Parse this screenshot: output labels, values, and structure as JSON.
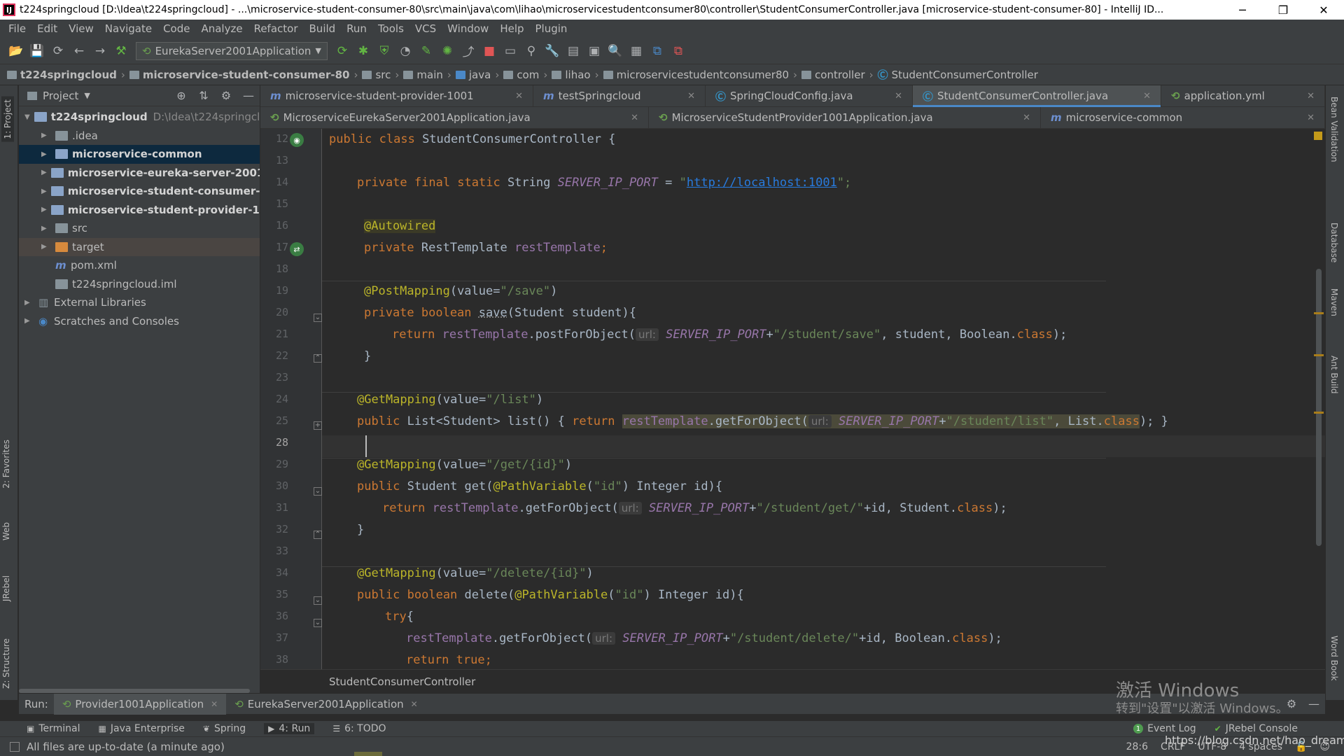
{
  "window": {
    "title": "t224springcloud [D:\\Idea\\t224springcloud] - ...\\microservice-student-consumer-80\\src\\main\\java\\com\\lihao\\microservicestudentconsumer80\\controller\\StudentConsumerController.java [microservice-student-consumer-80] - IntelliJ ID...",
    "app_icon": "IJ"
  },
  "menu": [
    "File",
    "Edit",
    "View",
    "Navigate",
    "Code",
    "Analyze",
    "Refactor",
    "Build",
    "Run",
    "Tools",
    "VCS",
    "Window",
    "Help",
    "Plugin"
  ],
  "toolbar": {
    "run_config": "EurekaServer2001Application"
  },
  "breadcrumb": [
    {
      "label": "t224springcloud",
      "bold": true
    },
    {
      "label": "microservice-student-consumer-80",
      "bold": true
    },
    {
      "label": "src"
    },
    {
      "label": "main"
    },
    {
      "label": "java"
    },
    {
      "label": "com"
    },
    {
      "label": "lihao"
    },
    {
      "label": "microservicestudentconsumer80"
    },
    {
      "label": "controller"
    },
    {
      "label": "StudentConsumerController"
    }
  ],
  "left_strip": {
    "project": "1: Project",
    "favorites": "2: Favorites",
    "web": "Web",
    "jrebel": "JRebel",
    "structure": "Z: Structure"
  },
  "right_strip": {
    "bean": "Bean Validation",
    "database": "Database",
    "maven": "Maven",
    "ant": "Ant Build",
    "word": "Word Book"
  },
  "project_panel": {
    "title": "Project",
    "tree": [
      {
        "label": "t224springcloud",
        "extra": "D:\\Idea\\t224springclou",
        "indent": 0,
        "arrow": "▼",
        "icon": "mod",
        "bold": true
      },
      {
        "label": ".idea",
        "indent": 1,
        "arrow": "▶",
        "icon": "fold"
      },
      {
        "label": "microservice-common",
        "indent": 1,
        "arrow": "▶",
        "icon": "mod",
        "bold": true,
        "selected": true
      },
      {
        "label": "microservice-eureka-server-2001",
        "indent": 1,
        "arrow": "▶",
        "icon": "mod",
        "bold": true
      },
      {
        "label": "microservice-student-consumer-80",
        "indent": 1,
        "arrow": "▶",
        "icon": "mod",
        "bold": true
      },
      {
        "label": "microservice-student-provider-1001",
        "indent": 1,
        "arrow": "▶",
        "icon": "mod",
        "bold": true
      },
      {
        "label": "src",
        "indent": 1,
        "arrow": "▶",
        "icon": "fold"
      },
      {
        "label": "target",
        "indent": 1,
        "arrow": "▶",
        "icon": "tgt",
        "highlighted": true
      },
      {
        "label": "pom.xml",
        "indent": 1,
        "arrow": "",
        "icon": "m"
      },
      {
        "label": "t224springcloud.iml",
        "indent": 1,
        "arrow": "",
        "icon": "fold"
      },
      {
        "label": "External Libraries",
        "indent": 0,
        "arrow": "▶",
        "icon": "lib"
      },
      {
        "label": "Scratches and Consoles",
        "indent": 0,
        "arrow": "▶",
        "icon": "scr"
      }
    ]
  },
  "tabs_row1": [
    {
      "label": "microservice-student-provider-1001",
      "icon": "m"
    },
    {
      "label": "testSpringcloud",
      "icon": "m"
    },
    {
      "label": "SpringCloudConfig.java",
      "icon": "c"
    },
    {
      "label": "StudentConsumerController.java",
      "icon": "c",
      "active": true
    },
    {
      "label": "application.yml",
      "icon": "s"
    }
  ],
  "tabs_row2": [
    {
      "label": "MicroserviceEurekaServer2001Application.java",
      "icon": "s"
    },
    {
      "label": "MicroserviceStudentProvider1001Application.java",
      "icon": "s"
    },
    {
      "label": "microservice-common",
      "icon": "m"
    }
  ],
  "editor": {
    "line_numbers": [
      "12",
      "13",
      "14",
      "15",
      "16",
      "17",
      "18",
      "19",
      "20",
      "21",
      "22",
      "23",
      "24",
      "25",
      "28",
      "29",
      "30",
      "31",
      "32",
      "33",
      "34",
      "35",
      "36",
      "37",
      "38"
    ],
    "code": {
      "l12": [
        "public class ",
        "StudentConsumerController {"
      ],
      "l14": [
        "private final static ",
        "String ",
        "SERVER_IP_PORT",
        " = ",
        "\"",
        "http://localhost:1001",
        "\";"
      ],
      "l16": [
        "@Autowired"
      ],
      "l17": [
        "private ",
        "RestTemplate ",
        "restTemplate",
        ";"
      ],
      "l19": [
        "@PostMapping",
        "(value=",
        "\"/save\"",
        ")"
      ],
      "l20": [
        "private boolean ",
        "save",
        "(Student student){"
      ],
      "l21": [
        "return ",
        "restTemplate",
        ".postForObject(",
        "url:",
        "SERVER_IP_PORT",
        "+",
        "\"/student/save\"",
        ", student, Boolean.",
        "class",
        ");"
      ],
      "l22": [
        "}"
      ],
      "l24": [
        "@GetMapping",
        "(value=",
        "\"/list\"",
        ")"
      ],
      "l25": [
        "public ",
        "List<Student> ",
        "list",
        "() { ",
        "return ",
        "restTemplate",
        ".getForObject(",
        "url:",
        "SERVER_IP_PORT",
        "+",
        "\"/student/list\"",
        ", List.",
        "class",
        "); }"
      ],
      "l29": [
        "@GetMapping",
        "(value=",
        "\"/get/{id}\"",
        ")"
      ],
      "l30": [
        "public ",
        "Student ",
        "get",
        "(",
        "@PathVariable",
        "(",
        "\"id\"",
        ") Integer id){"
      ],
      "l31": [
        "return ",
        "restTemplate",
        ".getForObject(",
        "url:",
        "SERVER_IP_PORT",
        "+",
        "\"/student/get/\"",
        "+id, Student.",
        "class",
        ");"
      ],
      "l32": [
        "}"
      ],
      "l34": [
        "@GetMapping",
        "(value=",
        "\"/delete/{id}\"",
        ")"
      ],
      "l35": [
        "public boolean ",
        "delete",
        "(",
        "@PathVariable",
        "(",
        "\"id\"",
        ") Integer id){"
      ],
      "l36": [
        "try",
        "{"
      ],
      "l37": [
        "restTemplate",
        ".getForObject(",
        "url:",
        "SERVER_IP_PORT",
        "+",
        "\"/student/delete/\"",
        "+id, Boolean.",
        "class",
        ");"
      ],
      "l38": [
        "return true",
        ";"
      ]
    },
    "breadcrumb": "StudentConsumerController"
  },
  "run_panel": {
    "label": "Run:",
    "tabs": [
      {
        "label": "Provider1001Application",
        "active": true
      },
      {
        "label": "EurekaServer2001Application"
      }
    ]
  },
  "bottom_tools": [
    {
      "label": "Terminal",
      "icon": "▣"
    },
    {
      "label": "Java Enterprise",
      "icon": "▦"
    },
    {
      "label": "Spring",
      "icon": "❦"
    },
    {
      "label": "4: Run",
      "icon": "▶",
      "active": true
    },
    {
      "label": "6: TODO",
      "icon": "☰"
    }
  ],
  "bottom_tools_right": [
    {
      "label": "Event Log",
      "icon": "1"
    },
    {
      "label": "JRebel Console",
      "icon": "✔"
    }
  ],
  "status": {
    "message": "All files are up-to-date (a minute ago)",
    "position": "28:6",
    "line_sep": "CRLF",
    "encoding": "UTF-8",
    "indent": "4 spaces"
  },
  "watermark": {
    "line1": "激活 Windows",
    "line2": "转到\"设置\"以激活 Windows。"
  },
  "url_overlay": "https://blog.csdn.net/hao_dream_xi"
}
